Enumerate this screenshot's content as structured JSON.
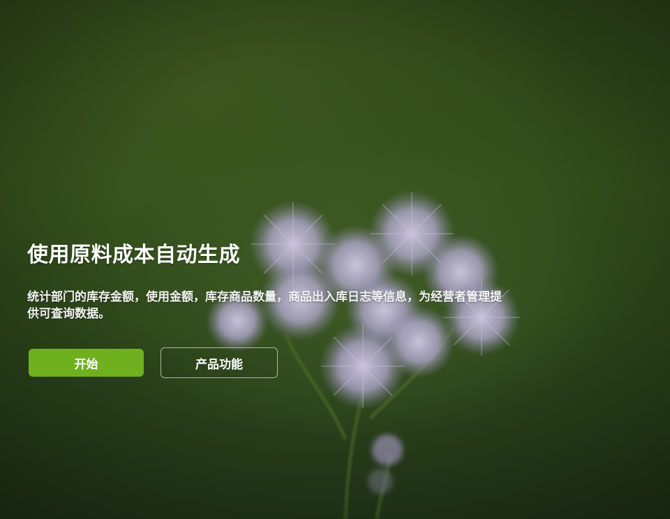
{
  "hero": {
    "title": "使用原料成本自动生成",
    "description": "统计部门的库存金额，使用金额，库存商品数量，商品出入库日志等信息，为经营者管理提供可查询数据。",
    "primary_button_label": "开始",
    "secondary_button_label": "产品功能"
  },
  "colors": {
    "primary_button": "#6fb01f",
    "background_green": "#34501c",
    "flower_lavender": "#b9aed6"
  }
}
